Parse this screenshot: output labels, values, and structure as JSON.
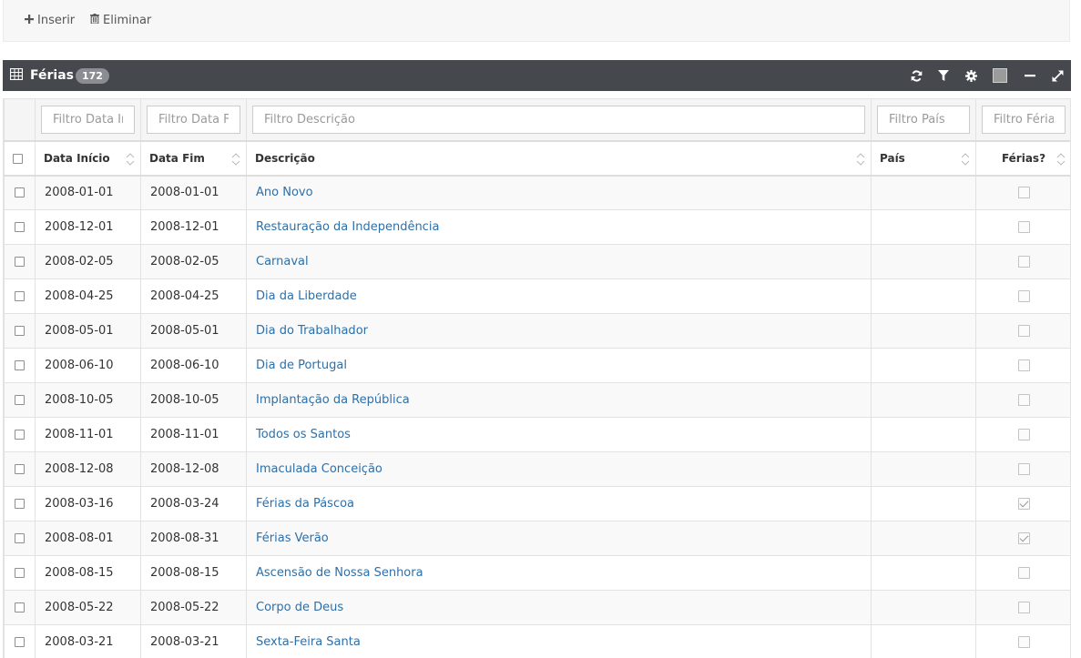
{
  "toolbar": {
    "insert_label": "Inserir",
    "delete_label": "Eliminar"
  },
  "header": {
    "title": "Férias",
    "count": "172"
  },
  "filters": {
    "data_inicio": "Filtro Data Início",
    "data_fim": "Filtro Data Fim",
    "descricao": "Filtro Descrição",
    "pais": "Filtro País",
    "ferias": "Filtro Férias"
  },
  "columns": {
    "data_inicio": "Data Início",
    "data_fim": "Data Fim",
    "descricao": "Descrição",
    "pais": "País",
    "ferias": "Férias?"
  },
  "rows": [
    {
      "inicio": "2008-01-01",
      "fim": "2008-01-01",
      "descricao": "Ano Novo",
      "pais": "",
      "ferias": false
    },
    {
      "inicio": "2008-12-01",
      "fim": "2008-12-01",
      "descricao": "Restauração da Independência",
      "pais": "",
      "ferias": false
    },
    {
      "inicio": "2008-02-05",
      "fim": "2008-02-05",
      "descricao": "Carnaval",
      "pais": "",
      "ferias": false
    },
    {
      "inicio": "2008-04-25",
      "fim": "2008-04-25",
      "descricao": "Dia da Liberdade",
      "pais": "",
      "ferias": false
    },
    {
      "inicio": "2008-05-01",
      "fim": "2008-05-01",
      "descricao": "Dia do Trabalhador",
      "pais": "",
      "ferias": false
    },
    {
      "inicio": "2008-06-10",
      "fim": "2008-06-10",
      "descricao": "Dia de Portugal",
      "pais": "",
      "ferias": false
    },
    {
      "inicio": "2008-10-05",
      "fim": "2008-10-05",
      "descricao": "Implantação da República",
      "pais": "",
      "ferias": false
    },
    {
      "inicio": "2008-11-01",
      "fim": "2008-11-01",
      "descricao": "Todos os Santos",
      "pais": "",
      "ferias": false
    },
    {
      "inicio": "2008-12-08",
      "fim": "2008-12-08",
      "descricao": "Imaculada Conceição",
      "pais": "",
      "ferias": false
    },
    {
      "inicio": "2008-03-16",
      "fim": "2008-03-24",
      "descricao": "Férias da Páscoa",
      "pais": "",
      "ferias": true
    },
    {
      "inicio": "2008-08-01",
      "fim": "2008-08-31",
      "descricao": "Férias Verão",
      "pais": "",
      "ferias": true
    },
    {
      "inicio": "2008-08-15",
      "fim": "2008-08-15",
      "descricao": "Ascensão de Nossa Senhora",
      "pais": "",
      "ferias": false
    },
    {
      "inicio": "2008-05-22",
      "fim": "2008-05-22",
      "descricao": "Corpo de Deus",
      "pais": "",
      "ferias": false
    },
    {
      "inicio": "2008-03-21",
      "fim": "2008-03-21",
      "descricao": "Sexta-Feira Santa",
      "pais": "",
      "ferias": false
    }
  ],
  "icons": {
    "insert": "plus-icon",
    "delete": "trash-icon",
    "grid": "table-grid-icon",
    "refresh": "refresh-icon",
    "filter": "filter-icon",
    "settings": "gear-icon",
    "color": "color-swatch-icon",
    "collapse": "minus-icon",
    "expand": "expand-icon"
  },
  "colors": {
    "header_bg": "#45494e",
    "link": "#2f6fa7",
    "badge_bg": "#8a8e93",
    "swatch": "#9b9b9b"
  }
}
